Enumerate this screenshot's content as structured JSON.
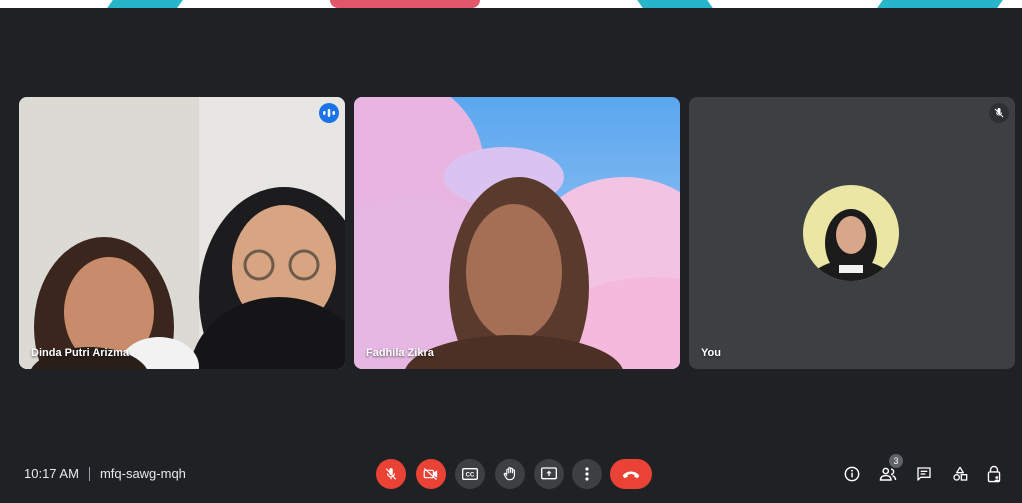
{
  "participants": [
    {
      "name": "Dinda Putri Arizma",
      "speaking": true
    },
    {
      "name": "Fadhila Zikra",
      "speaking": false
    },
    {
      "name": "You",
      "muted": true
    }
  ],
  "meeting": {
    "time": "10:17 AM",
    "code": "mfq-sawg-mqh"
  },
  "controls": {
    "mic": "mic-off-icon",
    "camera": "camera-off-icon",
    "captions": "captions-icon",
    "raise_hand": "raise-hand-icon",
    "present": "present-icon",
    "more": "more-options-icon",
    "leave": "leave-call-icon"
  },
  "side_controls": {
    "people_count": "3"
  },
  "colors": {
    "background": "#202124",
    "danger": "#ea4335",
    "active_outline": "#8ab4f8",
    "speaking_badge": "#1a73e8",
    "control_bg": "#3c4043"
  }
}
